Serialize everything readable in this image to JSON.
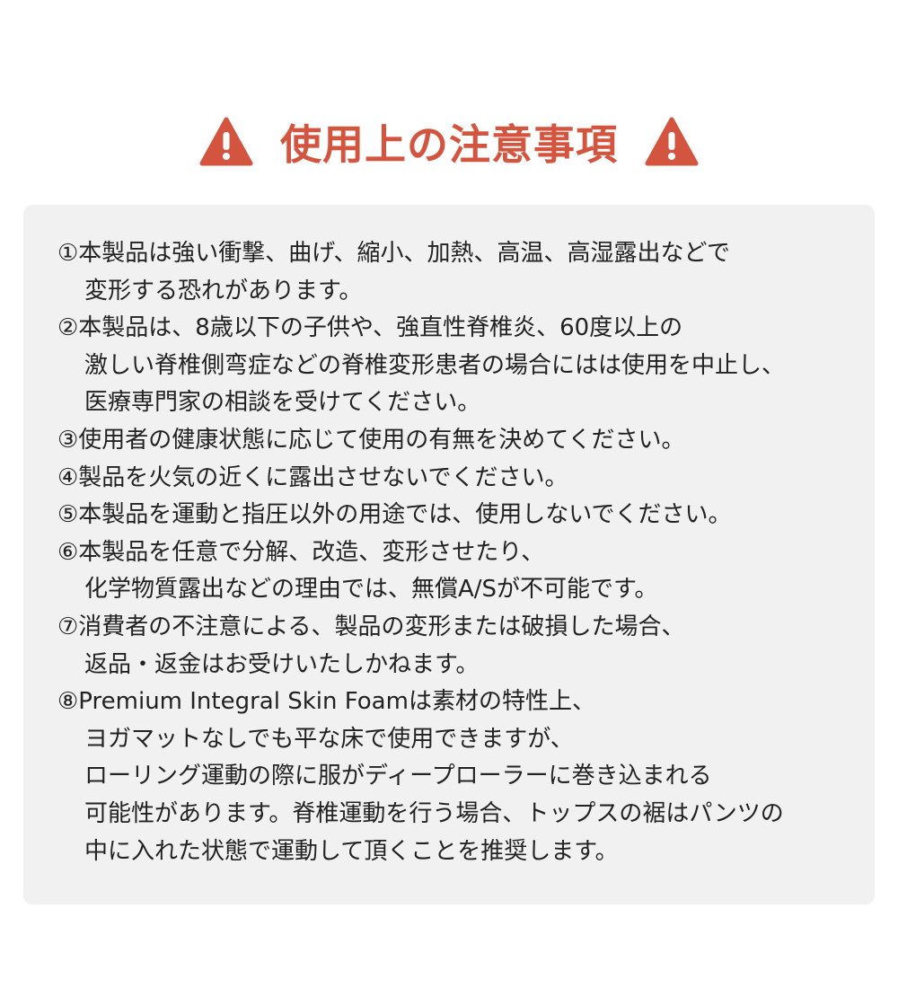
{
  "header": {
    "title": "使用上の注意事項",
    "accent_color": "#d4553f",
    "left_icon": "warning-triangle-icon",
    "right_icon": "warning-triangle-icon"
  },
  "notes": [
    {
      "lines": [
        "①本製品は強い衝撃、曲げ、縮小、加熱、高温、高湿露出などで",
        "変形する恐れがあります。"
      ]
    },
    {
      "lines": [
        "②本製品は、8歳以下の子供や、強直性脊椎炎、60度以上の",
        "激しい脊椎側弯症などの脊椎変形患者の場合にはは使用を中止し、",
        "医療専門家の相談を受けてください。"
      ]
    },
    {
      "lines": [
        "③使用者の健康状態に応じて使用の有無を決めてください。"
      ]
    },
    {
      "lines": [
        "④製品を火気の近くに露出させないでください。"
      ]
    },
    {
      "lines": [
        "⑤本製品を運動と指圧以外の用途では、使用しないでください。"
      ]
    },
    {
      "lines": [
        "⑥本製品を任意で分解、改造、変形させたり、",
        "化学物質露出などの理由では、無償A/Sが不可能です。"
      ]
    },
    {
      "lines": [
        "⑦消費者の不注意による、製品の変形または破損した場合、",
        "返品・返金はお受けいたしかねます。"
      ]
    },
    {
      "lines": [
        "⑧Premium Integral Skin Foamは素材の特性上、",
        "ヨガマットなしでも平な床で使用できますが、",
        "ローリング運動の際に服がディープローラーに巻き込まれる",
        "可能性があります。脊椎運動を行う場合、トップスの裾はパンツの",
        "中に入れた状態で運動して頂くことを推奨します。"
      ]
    }
  ]
}
